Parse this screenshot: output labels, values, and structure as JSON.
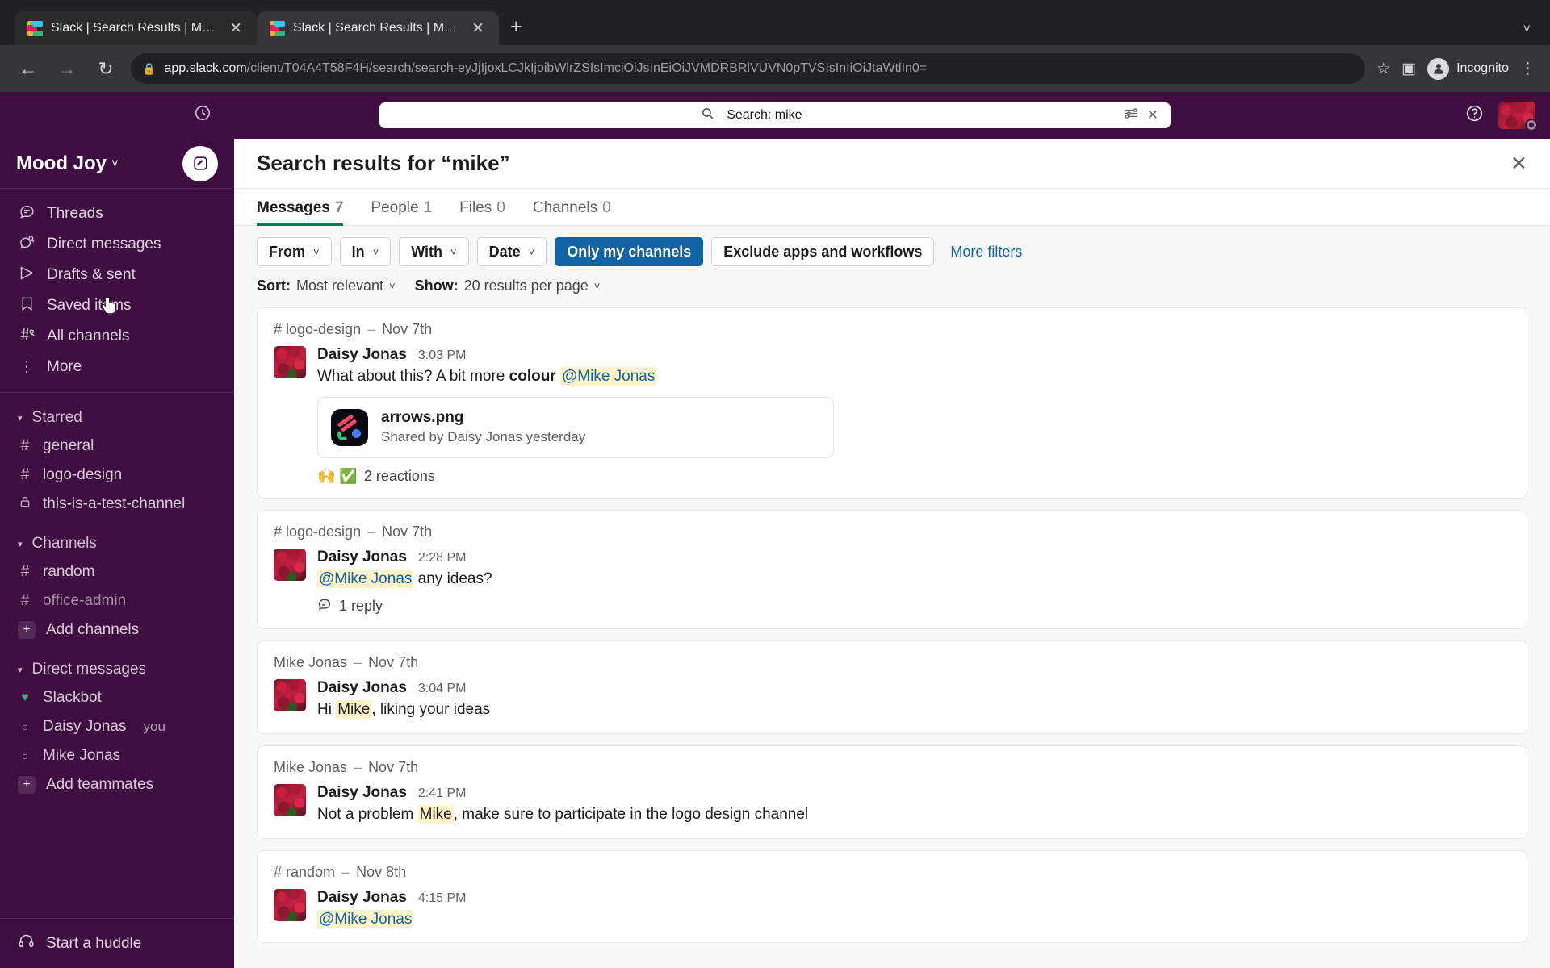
{
  "browser": {
    "tabs": [
      {
        "title": "Slack | Search Results | Mood ...",
        "close_label": "✕",
        "active": false
      },
      {
        "title": "Slack | Search Results | Mood ...",
        "close_label": "✕",
        "active": true
      }
    ],
    "new_tab_label": "+",
    "tabstrip_menu": "˅",
    "nav": {
      "back": "←",
      "forward": "→",
      "reload": "↻"
    },
    "url": {
      "lock": "🔒",
      "host": "app.slack.com",
      "path": "/client/T04A4T58F4H/search/search-eyJjIjoxLCJkIjoibWlrZSIsImciOiJsInEiOiJVMDRBRlVUVN0pTVSIsInIiOiJtaWtlIn0="
    },
    "star": "☆",
    "side_panel": "▣",
    "profile_label": "Incognito",
    "profile_icon": "🕵",
    "menu": "⋮"
  },
  "slack": {
    "topbar": {
      "history_icon": "history-clock",
      "search_value": "Search: mike",
      "search_icon": "search-icon",
      "filters_icon": "sliders-icon",
      "clear_icon": "✕",
      "help_icon": "?"
    },
    "sidebar": {
      "workspace_name": "Mood Joy",
      "workspace_caret": "˅",
      "compose_icon": "✎",
      "nav_items": [
        {
          "icon": "☰",
          "label": "Threads",
          "name": "threads"
        },
        {
          "icon": "❦",
          "label": "Direct messages",
          "name": "direct-messages"
        },
        {
          "icon": "▷",
          "label": "Drafts & sent",
          "name": "drafts-and-sent"
        },
        {
          "icon": "☐",
          "label": "Saved items",
          "name": "saved-items"
        },
        {
          "icon": "#",
          "label": "All channels",
          "name": "all-channels"
        },
        {
          "icon": "⋮",
          "label": "More",
          "name": "more"
        }
      ],
      "starred": {
        "title": "Starred",
        "caret": "▾",
        "items": [
          {
            "prefix": "#",
            "label": "general",
            "muted": false
          },
          {
            "prefix": "#",
            "label": "logo-design",
            "muted": false
          },
          {
            "prefix": "🔒",
            "label": "this-is-a-test-channel",
            "muted": false
          }
        ]
      },
      "channels": {
        "title": "Channels",
        "caret": "▾",
        "items": [
          {
            "prefix": "#",
            "label": "random",
            "muted": false
          },
          {
            "prefix": "#",
            "label": "office-admin",
            "muted": true
          }
        ],
        "add_label": "Add channels",
        "add_icon": "+"
      },
      "dms": {
        "title": "Direct messages",
        "caret": "▾",
        "items": [
          {
            "prefix": "♥",
            "label": "Slackbot",
            "tag": "",
            "heart": true
          },
          {
            "prefix": "○",
            "label": "Daisy Jonas",
            "tag": "you",
            "heart": false
          },
          {
            "prefix": "○",
            "label": "Mike Jonas",
            "tag": "",
            "heart": false
          }
        ],
        "add_label": "Add teammates",
        "add_icon": "+"
      },
      "huddle": {
        "icon": "☎",
        "label": "Start a huddle"
      }
    },
    "main": {
      "title": "Search results for “mike”",
      "close_icon": "✕",
      "tabs": [
        {
          "label": "Messages",
          "count": "7",
          "active": true
        },
        {
          "label": "People",
          "count": "1",
          "active": false
        },
        {
          "label": "Files",
          "count": "0",
          "active": false
        },
        {
          "label": "Channels",
          "count": "0",
          "active": false
        }
      ],
      "filters": [
        {
          "label": "From",
          "caret": "˅",
          "primary": false
        },
        {
          "label": "In",
          "caret": "˅",
          "primary": false
        },
        {
          "label": "With",
          "caret": "˅",
          "primary": false
        },
        {
          "label": "Date",
          "caret": "˅",
          "primary": false
        },
        {
          "label": "Only my channels",
          "caret": "",
          "primary": true
        },
        {
          "label": "Exclude apps and workflows",
          "caret": "",
          "primary": false
        }
      ],
      "more_filters": "More filters",
      "sort": {
        "label": "Sort:",
        "value": "Most relevant",
        "caret": "˅"
      },
      "show": {
        "label": "Show:",
        "value": "20 results per page",
        "caret": "˅"
      },
      "results": [
        {
          "context": "# logo-design",
          "sep": "–",
          "date": "Nov 7th",
          "author": "Daisy Jonas",
          "time": "3:03 PM",
          "text_parts": [
            {
              "t": "What about this? A bit more ",
              "style": "plain"
            },
            {
              "t": "colour",
              "style": "bold"
            },
            {
              "t": " ",
              "style": "plain"
            },
            {
              "t": "@Mike Jonas",
              "style": "mention"
            }
          ],
          "attachment": {
            "name": "arrows.png",
            "subtitle": "Shared by Daisy Jonas yesterday",
            "icon": "image-file-icon"
          },
          "reactions": {
            "emojis": "🙌 ✅",
            "text": "2 reactions"
          },
          "reply": null
        },
        {
          "context": "# logo-design",
          "sep": "–",
          "date": "Nov 7th",
          "author": "Daisy Jonas",
          "time": "2:28 PM",
          "text_parts": [
            {
              "t": "@Mike Jonas",
              "style": "mention"
            },
            {
              "t": " any ideas?",
              "style": "plain"
            }
          ],
          "attachment": null,
          "reactions": null,
          "reply": {
            "icon": "☰",
            "text": "1 reply"
          }
        },
        {
          "context": "Mike Jonas",
          "sep": "–",
          "date": "Nov 7th",
          "author": "Daisy Jonas",
          "time": "3:04 PM",
          "text_parts": [
            {
              "t": "Hi ",
              "style": "plain"
            },
            {
              "t": "Mike",
              "style": "highlight"
            },
            {
              "t": ", liking your ideas",
              "style": "plain"
            }
          ],
          "attachment": null,
          "reactions": null,
          "reply": null
        },
        {
          "context": "Mike Jonas",
          "sep": "–",
          "date": "Nov 7th",
          "author": "Daisy Jonas",
          "time": "2:41 PM",
          "text_parts": [
            {
              "t": "Not a problem ",
              "style": "plain"
            },
            {
              "t": "Mike",
              "style": "highlight"
            },
            {
              "t": ", make sure to participate in the logo design channel",
              "style": "plain"
            }
          ],
          "attachment": null,
          "reactions": null,
          "reply": null
        },
        {
          "context": "# random",
          "sep": "–",
          "date": "Nov 8th",
          "author": "Daisy Jonas",
          "time": "4:15 PM",
          "text_parts": [
            {
              "t": "@Mike Jonas",
              "style": "mention"
            }
          ],
          "attachment": null,
          "reactions": null,
          "reply": null
        }
      ]
    }
  }
}
